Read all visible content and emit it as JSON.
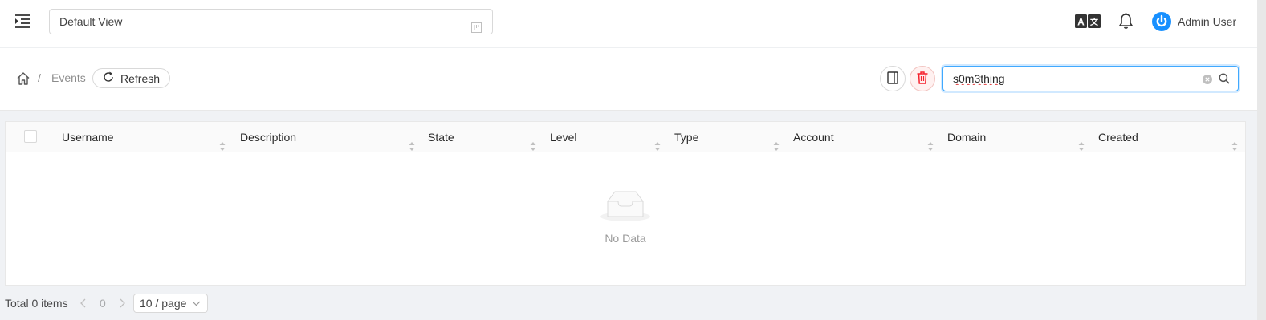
{
  "header": {
    "menu_icon": "menu-fold-icon",
    "view_select": {
      "value": "Default View",
      "icon": "project-icon"
    },
    "language_icon": "translate-icon",
    "notification_icon": "bell-icon",
    "user": {
      "name": "Admin User",
      "avatar_icon": "power-icon",
      "avatar_color": "#1890ff"
    }
  },
  "breadcrumb": {
    "home_icon": "home-icon",
    "separator": "/",
    "current": "Events",
    "refresh_label": "Refresh"
  },
  "toolbar": {
    "archive_icon": "archive-icon",
    "delete_icon": "delete-icon",
    "delete_color": "#f5222d",
    "search": {
      "value": "s0m3thing",
      "placeholder": ""
    }
  },
  "table": {
    "columns": [
      "Username",
      "Description",
      "State",
      "Level",
      "Type",
      "Account",
      "Domain",
      "Created"
    ],
    "rows": [],
    "empty_text": "No Data"
  },
  "pagination": {
    "total_text": "Total 0 items",
    "current_page": "0",
    "page_size": "10 / page"
  }
}
